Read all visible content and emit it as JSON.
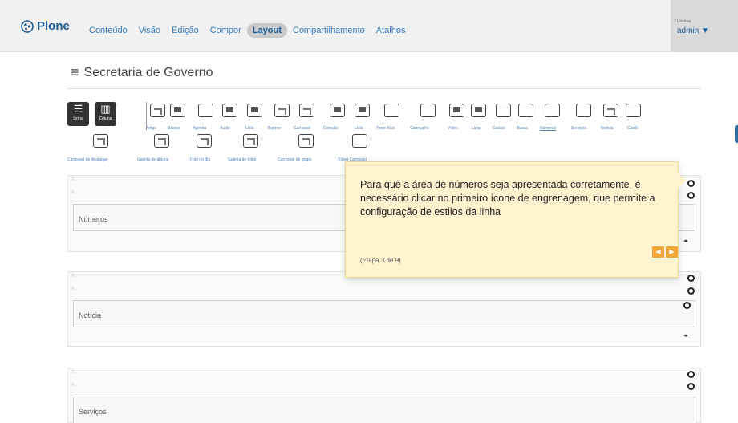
{
  "topbar": {
    "logo": "Plone",
    "nav": [
      "Conteúdo",
      "Visão",
      "Edição",
      "Compor",
      "Layout",
      "Compartilhamento",
      "Atalhos"
    ],
    "active_nav": "Layout",
    "user_label": "Usuário:",
    "username": "admin ▼"
  },
  "page": {
    "title": "Secretaria de Governo"
  },
  "toolbar": {
    "row_button": "Linha",
    "column_button": "Coluna",
    "tiles_row1": [
      "Artigo",
      "Básico",
      "Agenda",
      "Áudio",
      "Lista",
      "Banner",
      "Carrossel",
      "Coleção",
      "Lista",
      "Texto Rico",
      "Cabeçalho",
      "Vídeo",
      "Lista",
      "Canais",
      "Busca",
      "Números",
      "Serviços",
      "Notícia",
      "Cards"
    ],
    "tiles_row2": [
      "Carrossel de destaque",
      "Galeria de álbuns",
      "Foto do dia",
      "Galeria de fotos",
      "Carrossel de grupo",
      "Vídeo Carrossel"
    ]
  },
  "rows": [
    {
      "label": "Números"
    },
    {
      "label": "Notícia"
    },
    {
      "label": "Serviços"
    }
  ],
  "tour": {
    "text": "Para que a área de números seja apresentada corretamente, é necessário clicar no primeiro ícone de engrenagem, que permite a configuração de estilos da linha",
    "step": "(Etapa 3 de 9)",
    "prev": "◀",
    "next": "▶"
  },
  "colors": {
    "accent": "#1d5d96",
    "tour_bg": "#fff3cf",
    "tour_button": "#f4a63a"
  }
}
